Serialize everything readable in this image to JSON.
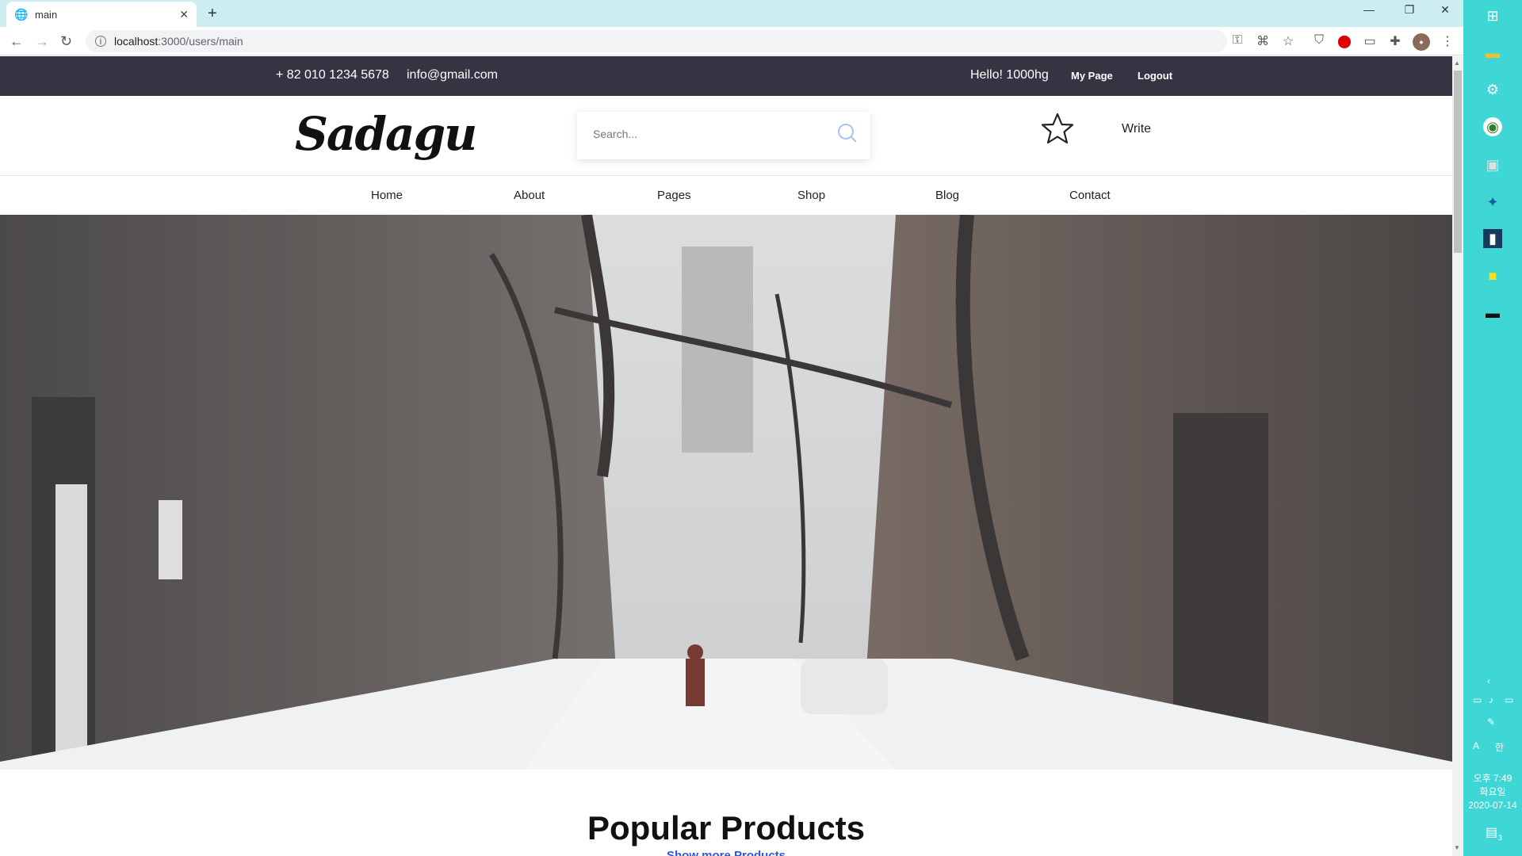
{
  "browser": {
    "tab_title": "main",
    "url_host": "localhost",
    "url_path": ":3000/users/main",
    "new_tab": "+",
    "close_tab": "✕"
  },
  "topbar": {
    "phone": "+ 82 010 1234 5678",
    "email": "info@gmail.com",
    "greeting": "Hello! 1000hg",
    "mypage": "My Page",
    "logout": "Logout"
  },
  "header": {
    "logo": "Sadagu",
    "search_placeholder": "Search...",
    "write": "Write"
  },
  "menu": [
    "Home",
    "About",
    "Pages",
    "Shop",
    "Blog",
    "Contact"
  ],
  "section": {
    "title": "Popular Products",
    "link": "Show more Products"
  },
  "taskbar": {
    "time": "오후 7:49",
    "day": "화요일",
    "date": "2020-07-14",
    "ime_a": "A",
    "ime_han": "한",
    "notif_count": "3"
  }
}
